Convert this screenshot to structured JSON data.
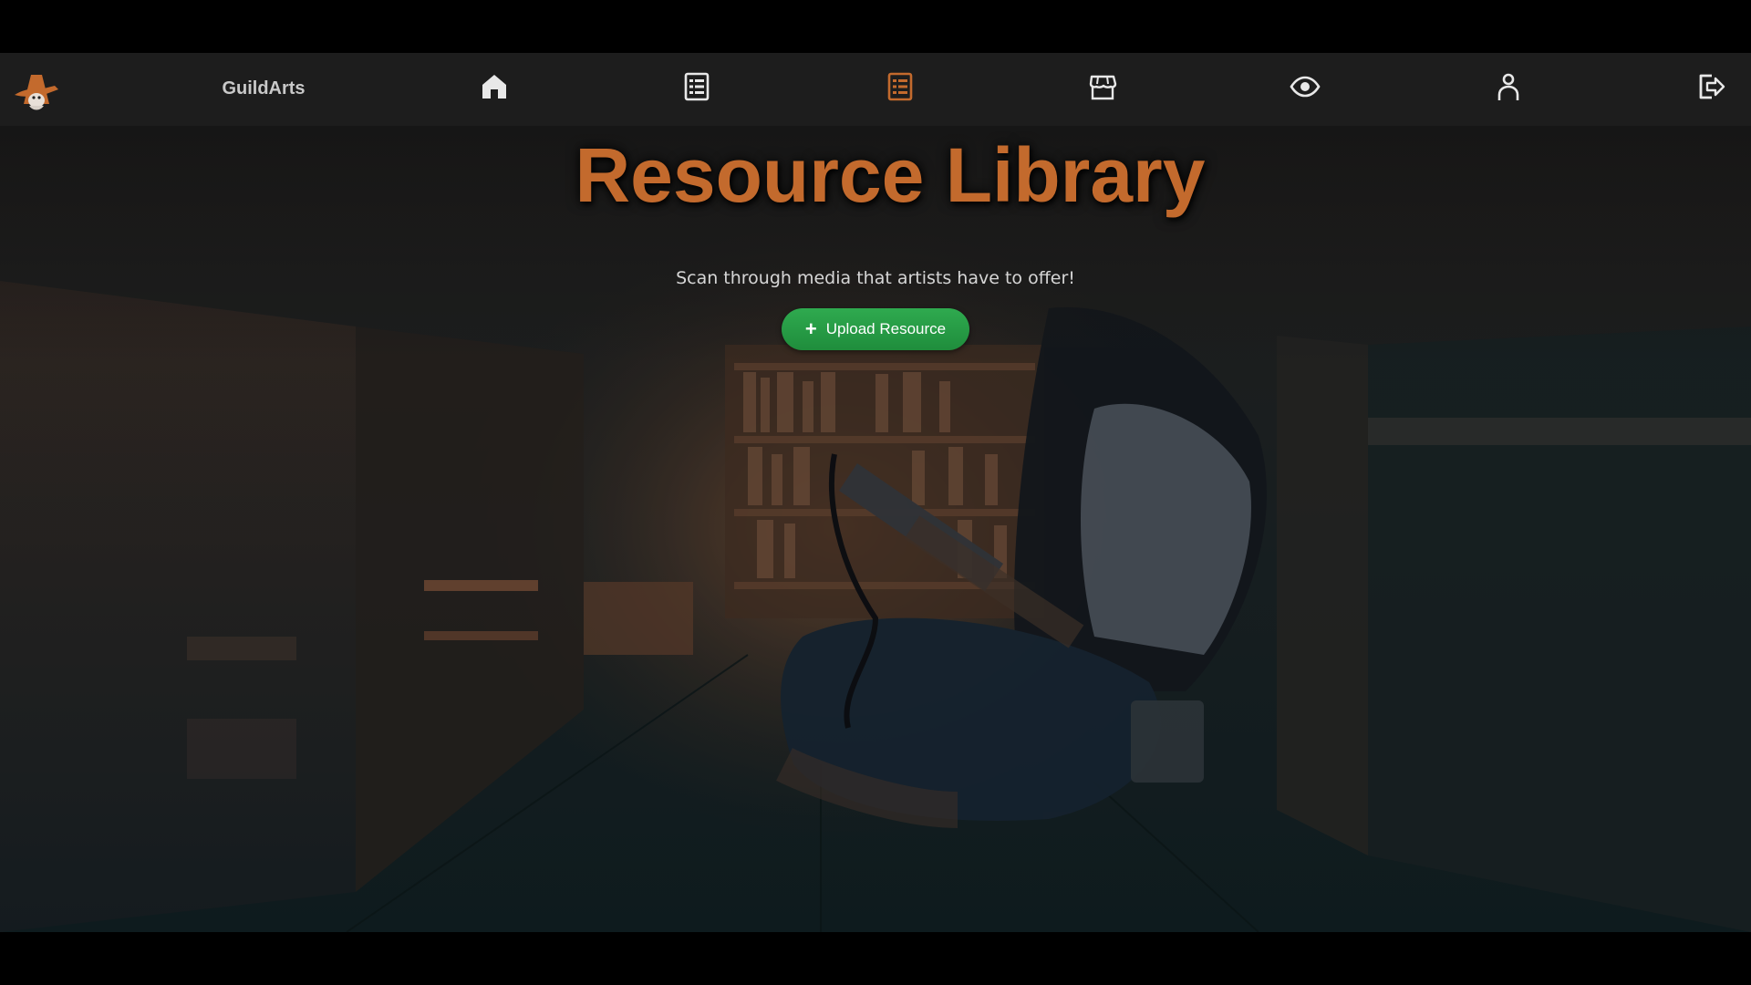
{
  "app": {
    "brand": "GuildArts"
  },
  "nav": {
    "items": [
      {
        "icon": "home-icon",
        "active": false
      },
      {
        "icon": "list-icon",
        "active": false
      },
      {
        "icon": "resource-list-icon",
        "active": true
      },
      {
        "icon": "store-icon",
        "active": false
      },
      {
        "icon": "eye-icon",
        "active": false
      },
      {
        "icon": "user-icon",
        "active": false
      },
      {
        "icon": "logout-icon",
        "active": false
      }
    ],
    "icon_color": "#e8e8e8",
    "active_color": "#c36a2d"
  },
  "hero": {
    "title": "Resource Library",
    "subtitle": "Scan through media that artists have to offer!",
    "upload_label": "Upload Resource",
    "title_color": "#c36a2d",
    "button_color": "#24a145"
  }
}
